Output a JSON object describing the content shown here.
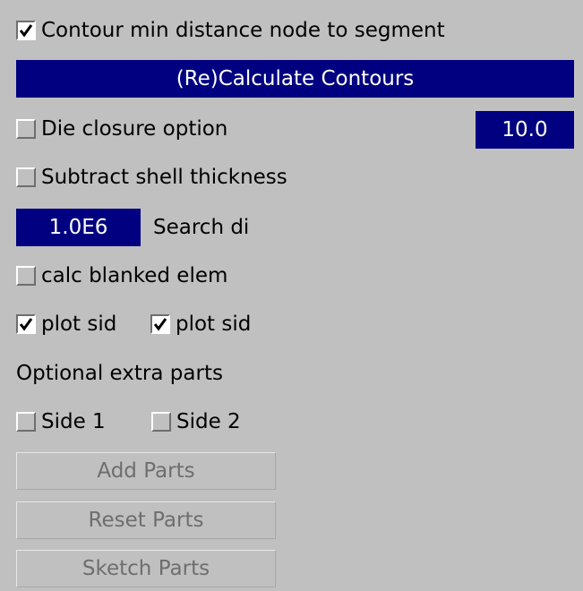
{
  "contour_min_distance": {
    "label": "Contour min distance node to segment",
    "checked": true
  },
  "recalculate_button": {
    "label": "(Re)Calculate Contours"
  },
  "die_closure": {
    "label": "Die closure option",
    "checked": false,
    "value": "10.0"
  },
  "subtract_shell": {
    "label": "Subtract shell thickness",
    "checked": false
  },
  "search_distance": {
    "value": "1.0E6",
    "label": "Search di"
  },
  "calc_blanked": {
    "label": "calc blanked elem",
    "checked": false
  },
  "plot_side_1": {
    "label": "plot sid",
    "checked": true
  },
  "plot_side_2": {
    "label": "plot sid",
    "checked": true
  },
  "optional_extra_parts": {
    "heading": "Optional extra parts"
  },
  "side_1": {
    "label": "Side 1",
    "checked": false
  },
  "side_2": {
    "label": "Side 2",
    "checked": false
  },
  "add_parts_button": {
    "label": "Add Parts",
    "enabled": false
  },
  "reset_parts_button": {
    "label": "Reset Parts",
    "enabled": false
  },
  "sketch_parts_button": {
    "label": "Sketch Parts",
    "enabled": false
  },
  "colors": {
    "panel_bg": "#c0c0c0",
    "highlight_bg": "#000080",
    "highlight_text": "#ffffff",
    "disabled_text": "#6e6e6e"
  }
}
